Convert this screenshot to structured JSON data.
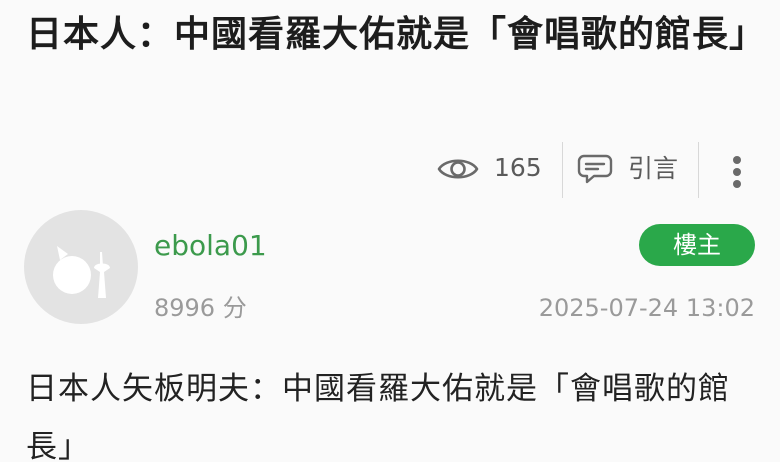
{
  "post": {
    "title": "日本人：中國看羅大佑就是「會唱歌的館長」",
    "content": "日本人矢板明夫：中國看羅大佑就是「會唱歌的館長」"
  },
  "meta": {
    "view_icon": "eye-icon",
    "views": "165",
    "quote_icon": "chat-bubbles-icon",
    "quote_label": "引言",
    "more_icon": "vertical-ellipsis-icon"
  },
  "author": {
    "avatar_icon": "default-avatar-icon",
    "name": "ebola01",
    "points": "8996 分",
    "badge": "樓主",
    "posted_at": "2025-07-24 13:02"
  },
  "colors": {
    "username": "#3c9a4c",
    "badge_bg": "#2aa84a",
    "meta_text": "#5a5a5a",
    "muted_text": "#9a9a9a",
    "background": "#fafafa"
  }
}
